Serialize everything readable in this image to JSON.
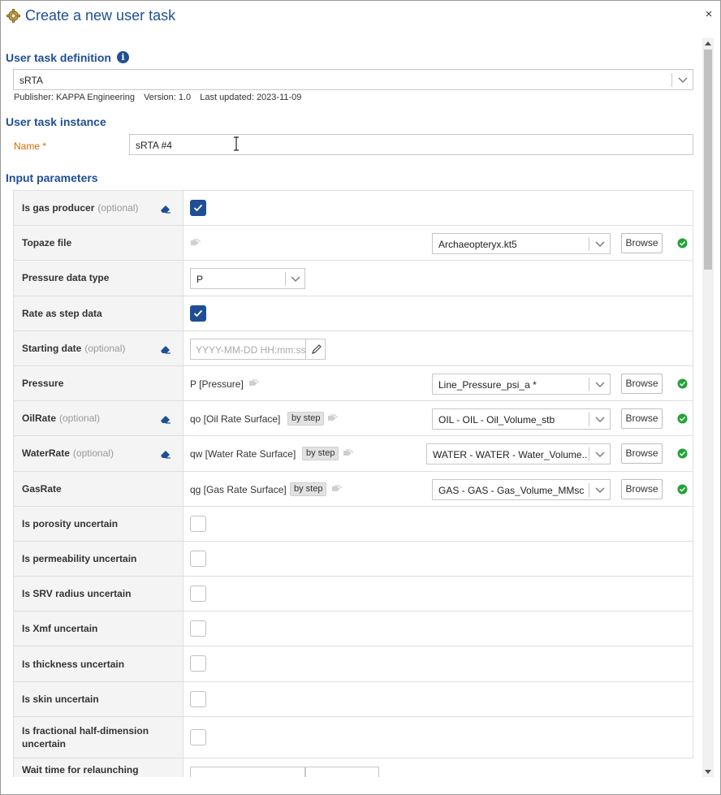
{
  "window": {
    "title": "Create a new user task",
    "close_label": "×"
  },
  "definition": {
    "heading": "User task definition",
    "selected": "sRTA",
    "publisher": "Publisher: KAPPA Engineering",
    "version": "Version: 1.0",
    "last_updated": "Last updated: 2023-11-09"
  },
  "instance": {
    "heading": "User task instance",
    "name_label": "Name *",
    "name_value": "sRTA #4"
  },
  "inputs": {
    "heading": "Input parameters",
    "optional_label": "(optional)",
    "browse_label": "Browse",
    "by_step_label": "by step",
    "rows": {
      "is_gas_producer": {
        "label": "Is gas producer",
        "checked": true
      },
      "topaze_file": {
        "label": "Topaze file",
        "value": "Archaeopteryx.kt5"
      },
      "pressure_data_type": {
        "label": "Pressure data type",
        "value": "P"
      },
      "rate_as_step": {
        "label": "Rate as step data",
        "checked": true
      },
      "starting_date": {
        "label": "Starting date",
        "placeholder": "YYYY-MM-DD HH:mm:ss"
      },
      "pressure": {
        "label": "Pressure",
        "param": "P [Pressure]",
        "value": "Line_Pressure_psi_a *"
      },
      "oil_rate": {
        "label": "OilRate",
        "param": "qo [Oil Rate Surface]",
        "value": "OIL - OIL - Oil_Volume_stb"
      },
      "water_rate": {
        "label": "WaterRate",
        "param": "qw [Water Rate Surface]",
        "value": "WATER - WATER - Water_Volume..."
      },
      "gas_rate": {
        "label": "GasRate",
        "param": "qg [Gas Rate Surface]",
        "value": "GAS - GAS - Gas_Volume_MMsc..."
      },
      "porosity": {
        "label": "Is porosity uncertain",
        "checked": false
      },
      "permeability": {
        "label": "Is permeability uncertain",
        "checked": false
      },
      "srv_radius": {
        "label": "Is SRV radius uncertain",
        "checked": false
      },
      "xmf": {
        "label": "Is Xmf uncertain",
        "checked": false
      },
      "thickness": {
        "label": "Is thickness uncertain",
        "checked": false
      },
      "skin": {
        "label": "Is skin uncertain",
        "checked": false
      },
      "frac_half_dim": {
        "label": "Is fractional half-dimension uncertain",
        "checked": false
      },
      "wait_time": {
        "label": "Wait time for relaunching"
      }
    }
  },
  "colors": {
    "accent": "#1f4e95",
    "required": "#d46a00",
    "ok": "#21a336"
  }
}
